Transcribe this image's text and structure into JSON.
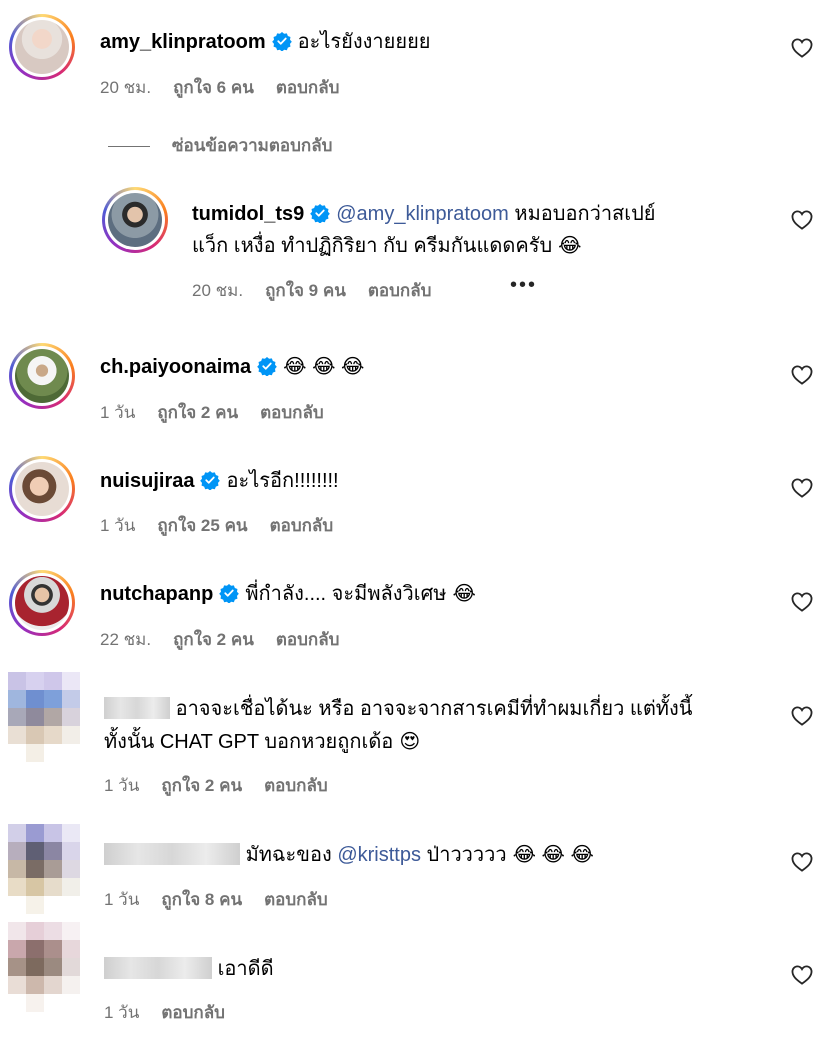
{
  "hide_replies_label": "ซ่อนข้อความตอบกลับ",
  "comments": [
    {
      "username": "amy_klinpratoom",
      "verified": true,
      "text": "อะไรยังงายยยย",
      "time": "20 ชม.",
      "likes": "ถูกใจ 6 คน",
      "reply": "ตอบกลับ"
    },
    {
      "username": "tumidol_ts9",
      "verified": true,
      "mention": "@amy_klinpratoom",
      "text_line1": " หมอบอกว่าสเปย์",
      "text_line2": "แว็ก เหงื่อ ทำปฏิกิริยา กับ ครีมกันแดดครับ",
      "emoji": "😂",
      "time": "20 ชม.",
      "likes": "ถูกใจ 9 คน",
      "reply": "ตอบกลับ",
      "more": "•••"
    },
    {
      "username": "ch.paiyoonaima",
      "verified": true,
      "text": "😂 😂 😂",
      "time": "1 วัน",
      "likes": "ถูกใจ 2 คน",
      "reply": "ตอบกลับ"
    },
    {
      "username": "nuisujiraa",
      "verified": true,
      "text": "อะไรอีก!!!!!!!!",
      "time": "1 วัน",
      "likes": "ถูกใจ 25 คน",
      "reply": "ตอบกลับ"
    },
    {
      "username": "nutchapanp",
      "verified": true,
      "text": "พี่กำลัง.... จะมีพลังวิเศษ",
      "emoji": "😂",
      "time": "22 ชม.",
      "likes": "ถูกใจ 2 คน",
      "reply": "ตอบกลับ"
    },
    {
      "text_line1": "อาจจะเชื่อได้นะ หรือ อาจจะจากสารเคมีที่ทำผมเกี่ยว แต่ทั้งนี้",
      "text_line2": "ทั้งนั้น CHAT GPT บอกหวยถูกเด้อ",
      "emoji": "😍",
      "time": "1 วัน",
      "likes": "ถูกใจ 2 คน",
      "reply": "ตอบกลับ"
    },
    {
      "text": "มัทฉะของ ",
      "mention": "@kristtps",
      "text_after": " ป่าววววว",
      "emoji": "😂 😂 😂",
      "time": "1 วัน",
      "likes": "ถูกใจ 8 คน",
      "reply": "ตอบกลับ"
    },
    {
      "text": "เอาดีดี",
      "time": "1 วัน",
      "reply": "ตอบกลับ"
    }
  ],
  "colors": {
    "muted": "#737373",
    "mention": "#3d5a98",
    "verified": "#0095f6"
  },
  "icons": [
    "heart-icon",
    "verified-badge-icon",
    "more-options-icon"
  ]
}
